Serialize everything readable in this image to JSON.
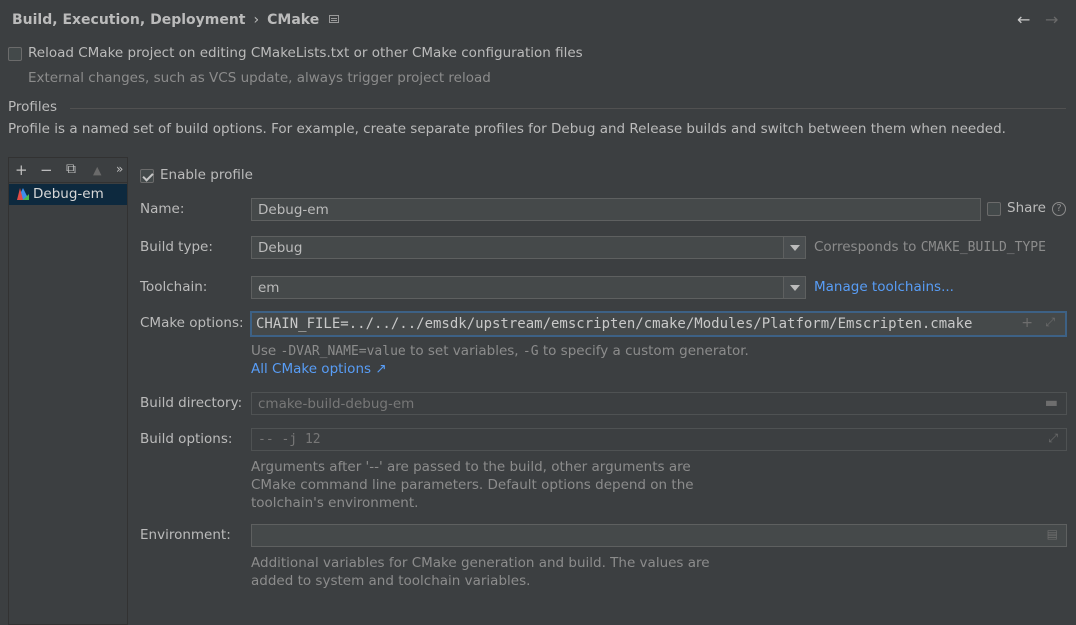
{
  "header": {
    "breadcrumb_parent": "Build, Execution, Deployment",
    "breadcrumb_separator": "›",
    "breadcrumb_current": "CMake",
    "back_icon": "arrow-left-icon",
    "forward_icon": "arrow-right-icon"
  },
  "reload": {
    "label": "Reload CMake project on editing CMakeLists.txt or other CMake configuration files",
    "checked": false,
    "hint": "External changes, such as VCS update, always trigger project reload"
  },
  "profiles": {
    "section_title": "Profiles",
    "description": "Profile is a named set of build options. For example, create separate profiles for Debug and Release builds and switch between them when needed.",
    "toolbar": {
      "add": "+",
      "remove": "−",
      "copy": "⧉",
      "move_up": "▲",
      "more": "»"
    },
    "items": [
      {
        "name": "Debug-em",
        "icon": "cmake-icon",
        "selected": true
      }
    ]
  },
  "form": {
    "enable_profile_label": "Enable profile",
    "enable_profile_checked": true,
    "name_label": "Name:",
    "name_value": "Debug-em",
    "share_label": "Share",
    "share_checked": false,
    "help_icon": "?",
    "build_type_label": "Build type:",
    "build_type_value": "Debug",
    "build_type_note_prefix": "Corresponds to ",
    "build_type_note_code": "CMAKE_BUILD_TYPE",
    "toolchain_label": "Toolchain:",
    "toolchain_value": "em",
    "manage_toolchains": "Manage toolchains...",
    "cmake_options_label": "CMake options:",
    "cmake_options_value": "CHAIN_FILE=../../../emsdk/upstream/emscripten/cmake/Modules/Platform/Emscripten.cmake",
    "cmake_hint_use": "Use ",
    "cmake_hint_d": "-DVAR_NAME=value",
    "cmake_hint_mid": " to set variables, ",
    "cmake_hint_g": "-G",
    "cmake_hint_end": " to specify a custom generator.",
    "all_cmake_options": "All CMake options ↗",
    "build_dir_label": "Build directory:",
    "build_dir_placeholder": "cmake-build-debug-em",
    "build_options_label": "Build options:",
    "build_options_placeholder": "-- -j 12",
    "build_options_hint_1": "Arguments after '--' are passed to the build, other arguments are",
    "build_options_hint_2": "CMake command line parameters. Default options depend on the",
    "build_options_hint_3": "toolchain's environment.",
    "environment_label": "Environment:",
    "environment_value": "",
    "environment_hint_1": "Additional variables for CMake generation and build. The values are",
    "environment_hint_2": "added to system and toolchain variables."
  },
  "colors": {
    "background": "#3c3f41",
    "selection": "#0d293e",
    "link": "#589df6",
    "focus": "#3d6185"
  }
}
